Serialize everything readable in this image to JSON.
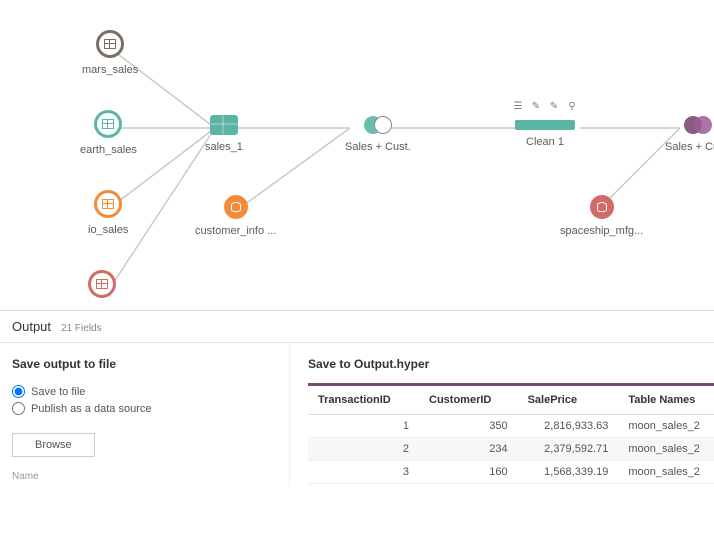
{
  "flow": {
    "nodes": {
      "mars_sales": {
        "label": "mars_sales"
      },
      "earth_sales": {
        "label": "earth_sales"
      },
      "io_sales": {
        "label": "io_sales"
      },
      "moon_sales": {
        "label": ""
      },
      "sales_1": {
        "label": "sales_1"
      },
      "customer_info": {
        "label": "customer_info ..."
      },
      "join1": {
        "label": "Sales + Cust."
      },
      "clean1": {
        "label": "Clean 1"
      },
      "spaceship": {
        "label": "spaceship_mfg..."
      },
      "join2": {
        "label": "Sales + Cust."
      }
    }
  },
  "output": {
    "title": "Output",
    "fields_label": "21 Fields",
    "save_heading": "Save output to file",
    "radio_save": "Save to file",
    "radio_publish": "Publish as a data source",
    "browse": "Browse",
    "name_label": "Name",
    "preview_title": "Save to Output.hyper",
    "columns": [
      "TransactionID",
      "CustomerID",
      "SalePrice",
      "Table Names"
    ],
    "rows": [
      {
        "tid": "1",
        "cid": "350",
        "price": "2,816,933.63",
        "tbl": "moon_sales_2"
      },
      {
        "tid": "2",
        "cid": "234",
        "price": "2,379,592.71",
        "tbl": "moon_sales_2"
      },
      {
        "tid": "3",
        "cid": "160",
        "price": "1,568,339.19",
        "tbl": "moon_sales_2"
      }
    ]
  }
}
